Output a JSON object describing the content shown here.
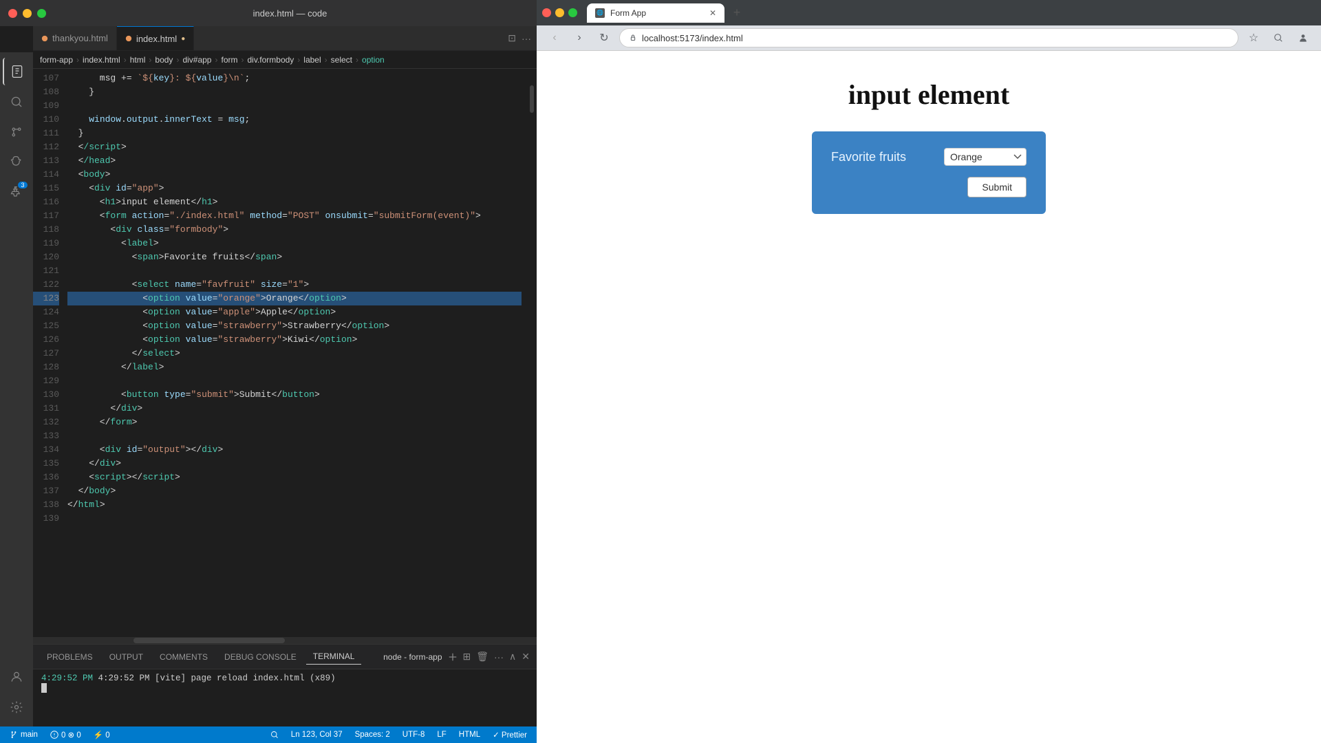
{
  "vscode": {
    "title": "index.html — code",
    "tabs": [
      {
        "label": "thankyou.html",
        "active": false,
        "modified": false
      },
      {
        "label": "index.html",
        "active": true,
        "modified": true
      }
    ],
    "breadcrumb": [
      "form-app",
      "index.html",
      "html",
      "body",
      "div#app",
      "form",
      "div.formbody",
      "label",
      "select",
      "option"
    ],
    "lines": [
      {
        "num": 107,
        "tokens": [
          {
            "t": "      ",
            "c": ""
          },
          {
            "t": "msg += ",
            "c": "text-white"
          },
          {
            "t": "`${",
            "c": "punc"
          },
          {
            "t": "key",
            "c": "var"
          },
          {
            "t": "}: ${",
            "c": "punc"
          },
          {
            "t": "value",
            "c": "var"
          },
          {
            "t": "}\\n`",
            "c": "punc"
          },
          {
            "t": ";",
            "c": "punc"
          }
        ]
      },
      {
        "num": 108,
        "tokens": [
          {
            "t": "    }",
            "c": "text-white"
          }
        ]
      },
      {
        "num": 109,
        "tokens": []
      },
      {
        "num": 110,
        "tokens": [
          {
            "t": "    ",
            "c": ""
          },
          {
            "t": "window",
            "c": "var"
          },
          {
            "t": ".",
            "c": "punc"
          },
          {
            "t": "output",
            "c": "var"
          },
          {
            "t": ".",
            "c": "punc"
          },
          {
            "t": "innerText",
            "c": "attr"
          },
          {
            "t": " = ",
            "c": "punc"
          },
          {
            "t": "msg",
            "c": "var"
          },
          {
            "t": ";",
            "c": "punc"
          }
        ]
      },
      {
        "num": 111,
        "tokens": [
          {
            "t": "  }",
            "c": "text-white"
          }
        ]
      },
      {
        "num": 112,
        "tokens": [
          {
            "t": "  <",
            "c": "punc"
          },
          {
            "t": "/script",
            "c": "tag"
          },
          {
            "t": ">",
            "c": "punc"
          }
        ]
      },
      {
        "num": 113,
        "tokens": [
          {
            "t": "  <",
            "c": "punc"
          },
          {
            "t": "/head",
            "c": "tag"
          },
          {
            "t": ">",
            "c": "punc"
          }
        ]
      },
      {
        "num": 114,
        "tokens": [
          {
            "t": "  <",
            "c": "punc"
          },
          {
            "t": "body",
            "c": "tag"
          },
          {
            "t": ">",
            "c": "punc"
          }
        ]
      },
      {
        "num": 115,
        "tokens": [
          {
            "t": "    <",
            "c": "punc"
          },
          {
            "t": "div",
            "c": "tag"
          },
          {
            "t": " ",
            "c": "text-white"
          },
          {
            "t": "id",
            "c": "attr"
          },
          {
            "t": "=",
            "c": "punc"
          },
          {
            "t": "\"app\"",
            "c": "str"
          },
          {
            "t": ">",
            "c": "punc"
          }
        ]
      },
      {
        "num": 116,
        "tokens": [
          {
            "t": "      <",
            "c": "punc"
          },
          {
            "t": "h1",
            "c": "tag"
          },
          {
            "t": ">",
            "c": "punc"
          },
          {
            "t": "input element",
            "c": "text-white"
          },
          {
            "t": "</",
            "c": "punc"
          },
          {
            "t": "h1",
            "c": "tag"
          },
          {
            "t": ">",
            "c": "punc"
          }
        ]
      },
      {
        "num": 117,
        "tokens": [
          {
            "t": "      <",
            "c": "punc"
          },
          {
            "t": "form",
            "c": "tag"
          },
          {
            "t": " ",
            "c": ""
          },
          {
            "t": "action",
            "c": "attr"
          },
          {
            "t": "=",
            "c": "punc"
          },
          {
            "t": "\"./index.html\"",
            "c": "str"
          },
          {
            "t": " ",
            "c": ""
          },
          {
            "t": "method",
            "c": "attr"
          },
          {
            "t": "=",
            "c": "punc"
          },
          {
            "t": "\"POST\"",
            "c": "str"
          },
          {
            "t": " ",
            "c": ""
          },
          {
            "t": "onsubmit",
            "c": "attr"
          },
          {
            "t": "=",
            "c": "punc"
          },
          {
            "t": "\"submitForm(event)\"",
            "c": "str"
          },
          {
            "t": ">",
            "c": "punc"
          }
        ]
      },
      {
        "num": 118,
        "tokens": [
          {
            "t": "        <",
            "c": "punc"
          },
          {
            "t": "div",
            "c": "tag"
          },
          {
            "t": " ",
            "c": ""
          },
          {
            "t": "class",
            "c": "attr"
          },
          {
            "t": "=",
            "c": "punc"
          },
          {
            "t": "\"formbody\"",
            "c": "str"
          },
          {
            "t": ">",
            "c": "punc"
          }
        ]
      },
      {
        "num": 119,
        "tokens": [
          {
            "t": "          <",
            "c": "punc"
          },
          {
            "t": "label",
            "c": "tag"
          },
          {
            "t": ">",
            "c": "punc"
          }
        ]
      },
      {
        "num": 120,
        "tokens": [
          {
            "t": "            <",
            "c": "punc"
          },
          {
            "t": "span",
            "c": "tag"
          },
          {
            "t": ">",
            "c": "punc"
          },
          {
            "t": "Favorite fruits",
            "c": "text-white"
          },
          {
            "t": "</",
            "c": "punc"
          },
          {
            "t": "span",
            "c": "tag"
          },
          {
            "t": ">",
            "c": "punc"
          }
        ]
      },
      {
        "num": 121,
        "tokens": []
      },
      {
        "num": 122,
        "tokens": [
          {
            "t": "            <",
            "c": "punc"
          },
          {
            "t": "select",
            "c": "tag"
          },
          {
            "t": " ",
            "c": ""
          },
          {
            "t": "name",
            "c": "attr"
          },
          {
            "t": "=",
            "c": "punc"
          },
          {
            "t": "\"favfruit\"",
            "c": "str"
          },
          {
            "t": " ",
            "c": ""
          },
          {
            "t": "size",
            "c": "attr"
          },
          {
            "t": "=",
            "c": "punc"
          },
          {
            "t": "\"1\"",
            "c": "str"
          },
          {
            "t": ">",
            "c": "punc"
          }
        ]
      },
      {
        "num": 123,
        "tokens": [
          {
            "t": "              <",
            "c": "punc"
          },
          {
            "t": "option",
            "c": "tag"
          },
          {
            "t": " ",
            "c": ""
          },
          {
            "t": "value",
            "c": "attr"
          },
          {
            "t": "=",
            "c": "punc"
          },
          {
            "t": "\"orange\"",
            "c": "str"
          },
          {
            "t": ">",
            "c": "punc"
          },
          {
            "t": "Orange",
            "c": "text-white"
          },
          {
            "t": "</",
            "c": "punc"
          },
          {
            "t": "option",
            "c": "tag"
          },
          {
            "t": ">",
            "c": "punc"
          }
        ],
        "highlighted": true
      },
      {
        "num": 124,
        "tokens": [
          {
            "t": "              <",
            "c": "punc"
          },
          {
            "t": "option",
            "c": "tag"
          },
          {
            "t": " ",
            "c": ""
          },
          {
            "t": "value",
            "c": "attr"
          },
          {
            "t": "=",
            "c": "punc"
          },
          {
            "t": "\"apple\"",
            "c": "str"
          },
          {
            "t": ">",
            "c": "punc"
          },
          {
            "t": "Apple",
            "c": "text-white"
          },
          {
            "t": "</",
            "c": "punc"
          },
          {
            "t": "option",
            "c": "tag"
          },
          {
            "t": ">",
            "c": "punc"
          }
        ]
      },
      {
        "num": 125,
        "tokens": [
          {
            "t": "              <",
            "c": "punc"
          },
          {
            "t": "option",
            "c": "tag"
          },
          {
            "t": " ",
            "c": ""
          },
          {
            "t": "value",
            "c": "attr"
          },
          {
            "t": "=",
            "c": "punc"
          },
          {
            "t": "\"strawberry\"",
            "c": "str"
          },
          {
            "t": ">",
            "c": "punc"
          },
          {
            "t": "Strawberry",
            "c": "text-white"
          },
          {
            "t": "</",
            "c": "punc"
          },
          {
            "t": "option",
            "c": "tag"
          },
          {
            "t": ">",
            "c": "punc"
          }
        ]
      },
      {
        "num": 126,
        "tokens": [
          {
            "t": "              <",
            "c": "punc"
          },
          {
            "t": "option",
            "c": "tag"
          },
          {
            "t": " ",
            "c": ""
          },
          {
            "t": "value",
            "c": "attr"
          },
          {
            "t": "=",
            "c": "punc"
          },
          {
            "t": "\"strawberry\"",
            "c": "str"
          },
          {
            "t": ">",
            "c": "punc"
          },
          {
            "t": "Kiwi",
            "c": "text-white"
          },
          {
            "t": "</",
            "c": "punc"
          },
          {
            "t": "option",
            "c": "tag"
          },
          {
            "t": ">",
            "c": "punc"
          }
        ]
      },
      {
        "num": 127,
        "tokens": [
          {
            "t": "            </",
            "c": "punc"
          },
          {
            "t": "select",
            "c": "tag"
          },
          {
            "t": ">",
            "c": "punc"
          }
        ]
      },
      {
        "num": 128,
        "tokens": [
          {
            "t": "          </",
            "c": "punc"
          },
          {
            "t": "label",
            "c": "tag"
          },
          {
            "t": ">",
            "c": "punc"
          }
        ]
      },
      {
        "num": 129,
        "tokens": []
      },
      {
        "num": 130,
        "tokens": [
          {
            "t": "          <",
            "c": "punc"
          },
          {
            "t": "button",
            "c": "tag"
          },
          {
            "t": " ",
            "c": ""
          },
          {
            "t": "type",
            "c": "attr"
          },
          {
            "t": "=",
            "c": "punc"
          },
          {
            "t": "\"submit\"",
            "c": "str"
          },
          {
            "t": ">",
            "c": "punc"
          },
          {
            "t": "Submit",
            "c": "text-white"
          },
          {
            "t": "</",
            "c": "punc"
          },
          {
            "t": "button",
            "c": "tag"
          },
          {
            "t": ">",
            "c": "punc"
          }
        ]
      },
      {
        "num": 131,
        "tokens": [
          {
            "t": "        </",
            "c": "punc"
          },
          {
            "t": "div",
            "c": "tag"
          },
          {
            "t": ">",
            "c": "punc"
          }
        ]
      },
      {
        "num": 132,
        "tokens": [
          {
            "t": "      </",
            "c": "punc"
          },
          {
            "t": "form",
            "c": "tag"
          },
          {
            "t": ">",
            "c": "punc"
          }
        ]
      },
      {
        "num": 133,
        "tokens": []
      },
      {
        "num": 134,
        "tokens": [
          {
            "t": "      <",
            "c": "punc"
          },
          {
            "t": "div",
            "c": "tag"
          },
          {
            "t": " ",
            "c": ""
          },
          {
            "t": "id",
            "c": "attr"
          },
          {
            "t": "=",
            "c": "punc"
          },
          {
            "t": "\"output\"",
            "c": "str"
          },
          {
            "t": "></",
            "c": "punc"
          },
          {
            "t": "div",
            "c": "tag"
          },
          {
            "t": ">",
            "c": "punc"
          }
        ]
      },
      {
        "num": 135,
        "tokens": [
          {
            "t": "    </",
            "c": "punc"
          },
          {
            "t": "div",
            "c": "tag"
          },
          {
            "t": ">",
            "c": "punc"
          }
        ]
      },
      {
        "num": 136,
        "tokens": [
          {
            "t": "    <",
            "c": "punc"
          },
          {
            "t": "script",
            "c": "tag"
          },
          {
            "t": "></",
            "c": "punc"
          },
          {
            "t": "script",
            "c": "tag"
          },
          {
            "t": ">",
            "c": "punc"
          }
        ]
      },
      {
        "num": 137,
        "tokens": [
          {
            "t": "  </",
            "c": "punc"
          },
          {
            "t": "body",
            "c": "tag"
          },
          {
            "t": ">",
            "c": "punc"
          }
        ]
      },
      {
        "num": 138,
        "tokens": [
          {
            "t": "</",
            "c": "punc"
          },
          {
            "t": "html",
            "c": "tag"
          },
          {
            "t": ">",
            "c": "punc"
          }
        ]
      },
      {
        "num": 139,
        "tokens": []
      }
    ],
    "terminal": {
      "tabs": [
        "PROBLEMS",
        "OUTPUT",
        "COMMENTS",
        "DEBUG CONSOLE",
        "TERMINAL"
      ],
      "active_tab": "TERMINAL",
      "node_label": "node - form-app",
      "content": "4:29:52 PM [vite] page reload index.html (x89)"
    },
    "status_bar": {
      "left": [
        "⑂ main",
        "⚠ 0  ⊗ 0",
        "⚡ 0"
      ],
      "right": [
        "Ln 123, Col 37",
        "Spaces: 2",
        "UTF-8",
        "LF",
        "HTML",
        "✓ Prettier"
      ]
    },
    "activity_icons": [
      "files",
      "search",
      "source-control",
      "run-debug",
      "extensions"
    ],
    "bottom_icons": [
      "account",
      "settings"
    ]
  },
  "browser": {
    "title": "Form App",
    "url": "localhost:5173/index.html",
    "app_title": "input element",
    "form": {
      "label": "Favorite fruits",
      "select_value": "Orange",
      "options": [
        "Orange",
        "Apple",
        "Strawberry",
        "Kiwi"
      ],
      "submit_label": "Submit"
    }
  }
}
